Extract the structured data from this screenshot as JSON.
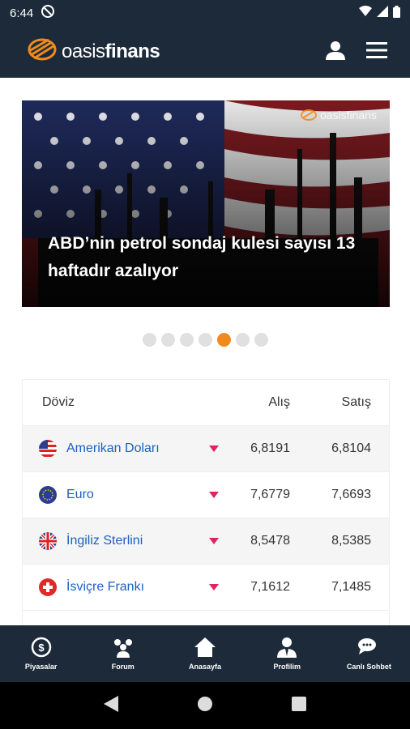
{
  "status": {
    "time": "6:44"
  },
  "app": {
    "logo_thin": "oasis",
    "logo_bold": "finans"
  },
  "banner": {
    "headline": "ABD’nin petrol sondaj kulesi sayısı 13 haftadır azalıyor",
    "brand": "oasisfinans",
    "dots_total": 7,
    "dots_active": 5
  },
  "table": {
    "headers": {
      "name": "Döviz",
      "buy": "Alış",
      "sell": "Satış"
    },
    "rows": [
      {
        "name": "Amerikan Doları",
        "buy": "6,8191",
        "sell": "6,8104",
        "flag": "us-flag-icon",
        "trend": "down"
      },
      {
        "name": "Euro",
        "buy": "7,6779",
        "sell": "7,6693",
        "flag": "eu-flag-icon",
        "trend": "down"
      },
      {
        "name": "İngiliz Sterlini",
        "buy": "8,5478",
        "sell": "8,5385",
        "flag": "uk-flag-icon",
        "trend": "down"
      },
      {
        "name": "İsviçre Frankı",
        "buy": "7,1612",
        "sell": "7,1485",
        "flag": "ch-flag-icon",
        "trend": "down"
      }
    ]
  },
  "bottom_nav": [
    {
      "label": "Piyasalar",
      "icon": "markets-icon"
    },
    {
      "label": "Forum",
      "icon": "forum-icon"
    },
    {
      "label": "Anasayfa",
      "icon": "home-icon"
    },
    {
      "label": "Profilim",
      "icon": "profile-icon"
    },
    {
      "label": "Canlı Sohbet",
      "icon": "chat-icon"
    }
  ],
  "colors": {
    "primary": "#1c2a3a",
    "accent": "#f08a1c",
    "link": "#1e5fbf",
    "down": "#e0245e"
  }
}
